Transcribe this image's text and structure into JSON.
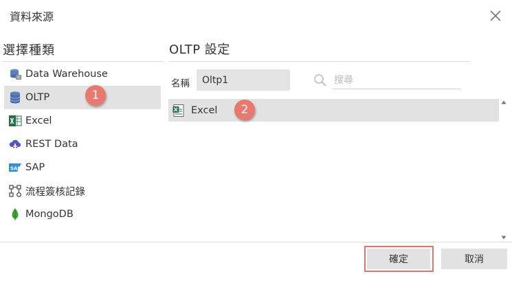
{
  "dialog": {
    "title": "資料來源",
    "close_icon": "close-icon"
  },
  "left_panel": {
    "heading": "選擇種類",
    "items": [
      {
        "label": "Data Warehouse",
        "icon": "data-warehouse-icon",
        "selected": false
      },
      {
        "label": "OLTP",
        "icon": "database-icon",
        "selected": true
      },
      {
        "label": "Excel",
        "icon": "excel-icon",
        "selected": false
      },
      {
        "label": "REST Data",
        "icon": "rest-cloud-icon",
        "selected": false
      },
      {
        "label": "SAP",
        "icon": "sap-icon",
        "selected": false
      },
      {
        "label": "流程簽核記錄",
        "icon": "workflow-icon",
        "selected": false
      },
      {
        "label": "MongoDB",
        "icon": "mongodb-leaf-icon",
        "selected": false
      }
    ]
  },
  "right_panel": {
    "heading": "OLTP 設定",
    "name_label": "名稱",
    "name_value": "Oltp1",
    "search_placeholder": "搜尋",
    "files": [
      {
        "label": "Excel",
        "icon": "excel-file-icon",
        "selected": true
      }
    ]
  },
  "buttons": {
    "ok_label": "確定",
    "cancel_label": "取消"
  },
  "annotations": {
    "badge_1": "1",
    "badge_2": "2",
    "color": "#e9796f"
  },
  "colors": {
    "selection_bg": "#e2e2e2",
    "highlight_outline": "#e0736a"
  }
}
